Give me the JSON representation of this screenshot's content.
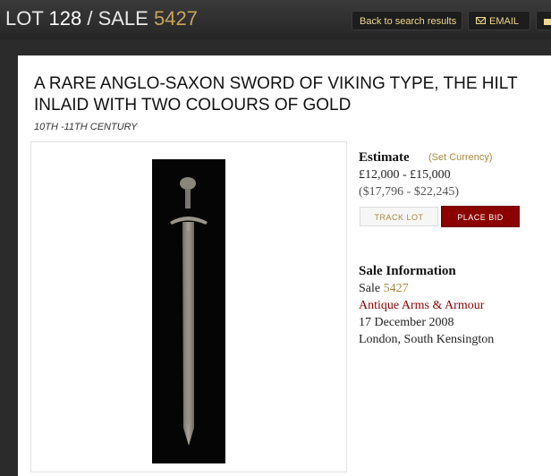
{
  "header": {
    "lot_prefix": "LOT",
    "lot_number": "128",
    "separator": " / ",
    "sale_prefix": "SALE",
    "sale_number": "5427",
    "back_label": "Back to search results",
    "email_label": "EMAIL",
    "email_icon": "envelope-icon",
    "print_icon": "printer-icon"
  },
  "lot": {
    "title": "A RARE ANGLO-SAXON SWORD OF VIKING TYPE, THE HILT INLAID WITH TWO COLOURS OF GOLD",
    "subtitle": "10TH -11TH CENTURY",
    "image_subject": "sword"
  },
  "estimate": {
    "label": "Estimate",
    "currency_link": "(Set Currency)",
    "gbp": "£12,000 - £15,000",
    "usd": "($17,796 - $22,245)"
  },
  "actions": {
    "track_label": "TRACK LOT",
    "bid_label": "PLACE BID"
  },
  "sale_info": {
    "label": "Sale Information",
    "sale_prefix": "Sale",
    "sale_number": "5427",
    "sale_name": "Antique Arms & Armour",
    "date": "17 December 2008",
    "location": "London, South Kensington"
  },
  "colors": {
    "accent_gold": "#a98a3c",
    "bid_red": "#8b0000",
    "header_bg": "#2b2b2b"
  }
}
